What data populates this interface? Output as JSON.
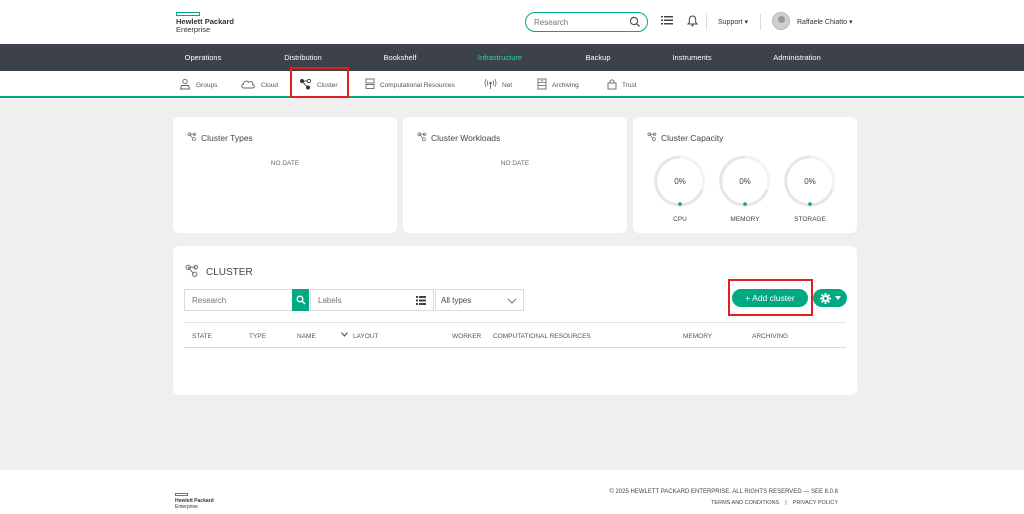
{
  "header": {
    "logo_line1": "Hewlett Packard",
    "logo_line2": "Enterprise",
    "search_placeholder": "Research",
    "support_label": "Support",
    "user_name": "Raffaele Chiatto"
  },
  "main_nav": {
    "items": [
      {
        "label": "Operations"
      },
      {
        "label": "Distribution"
      },
      {
        "label": "Bookshelf"
      },
      {
        "label": "Infrastructure",
        "active": true
      },
      {
        "label": "Backup"
      },
      {
        "label": "Instruments"
      },
      {
        "label": "Administration"
      }
    ]
  },
  "sub_nav": {
    "items": [
      {
        "label": "Groups",
        "icon": "groups-icon"
      },
      {
        "label": "Cloud",
        "icon": "cloud-icon"
      },
      {
        "label": "Cluster",
        "icon": "cluster-icon",
        "active": true
      },
      {
        "label": "Computational Resources",
        "icon": "server-icon"
      },
      {
        "label": "Net",
        "icon": "network-icon"
      },
      {
        "label": "Archiving",
        "icon": "archive-icon"
      },
      {
        "label": "Trust",
        "icon": "lock-icon"
      }
    ]
  },
  "cards": {
    "cluster_types": {
      "title": "Cluster Types",
      "empty": "NO DATE"
    },
    "cluster_workloads": {
      "title": "Cluster Workloads",
      "empty": "NO DATE"
    },
    "cluster_capacity": {
      "title": "Cluster Capacity",
      "gauges": [
        {
          "label": "CPU",
          "value": "0%"
        },
        {
          "label": "MEMORY",
          "value": "0%"
        },
        {
          "label": "STORAGE",
          "value": "0%"
        }
      ]
    }
  },
  "cluster_panel": {
    "title": "CLUSTER",
    "search_placeholder": "Research",
    "labels_placeholder": "Labels",
    "type_filter": "All types",
    "add_button": "+ Add cluster",
    "columns": [
      "STATE",
      "TYPE",
      "NAME",
      "LAYOUT",
      "WORKER",
      "COMPUTATIONAL RESOURCES",
      "MEMORY",
      "ARCHIVING"
    ]
  },
  "footer": {
    "logo_line1": "Hewlett Packard",
    "logo_line2": "Enterprise",
    "copyright": "© 2025 HEWLETT PACKARD ENTERPRISE. ALL RIGHTS RESERVED — SEE 8.0.8",
    "terms": "TERMS AND CONDITIONS",
    "separator": "|",
    "privacy": "PRIVACY POLICY"
  },
  "colors": {
    "accent": "#01a982",
    "nav_bg": "#3c414b",
    "highlight": "#e02020"
  }
}
